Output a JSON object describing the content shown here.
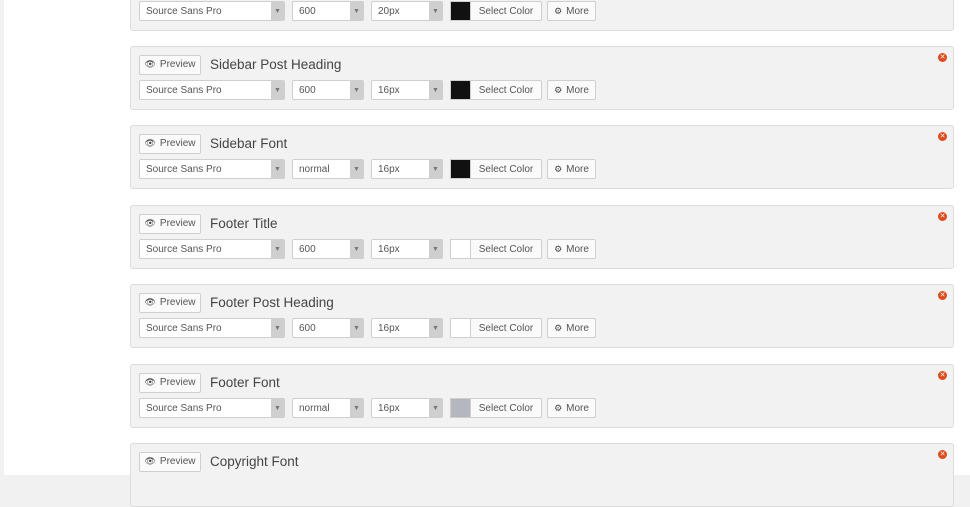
{
  "preview_label": "Preview",
  "select_color_label": "Select Color",
  "more_label": "More",
  "icons": {
    "preview": "eye-icon",
    "more": "gear-icon",
    "remove": "close-circle-icon"
  },
  "colors": {
    "remove": "#e1491b"
  },
  "panels": [
    {
      "title": "",
      "family": "Source Sans Pro",
      "weight": "600",
      "size": "20px",
      "color": "#111111",
      "has_head": false
    },
    {
      "title": "Sidebar Post Heading",
      "family": "Source Sans Pro",
      "weight": "600",
      "size": "16px",
      "color": "#111111",
      "has_head": true
    },
    {
      "title": "Sidebar Font",
      "family": "Source Sans Pro",
      "weight": "normal",
      "size": "16px",
      "color": "#111111",
      "has_head": true
    },
    {
      "title": "Footer Title",
      "family": "Source Sans Pro",
      "weight": "600",
      "size": "16px",
      "color": "#ffffff",
      "has_head": true
    },
    {
      "title": "Footer Post Heading",
      "family": "Source Sans Pro",
      "weight": "600",
      "size": "16px",
      "color": "#ffffff",
      "has_head": true
    },
    {
      "title": "Footer Font",
      "family": "Source Sans Pro",
      "weight": "normal",
      "size": "16px",
      "color": "#b4b7bd",
      "has_head": true
    },
    {
      "title": "Copyright Font",
      "family": "",
      "weight": "",
      "size": "",
      "color": "",
      "has_head": true
    }
  ]
}
